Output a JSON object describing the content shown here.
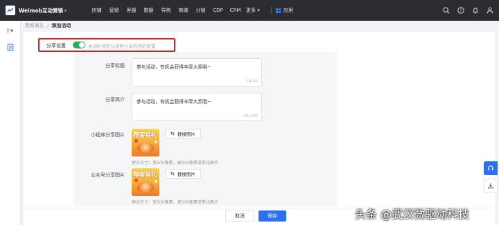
{
  "brand": {
    "name": "Weimob互动营销",
    "caret": "▾"
  },
  "nav": {
    "items": [
      "店铺",
      "营销",
      "客服",
      "数据",
      "导购",
      "商城",
      "分销",
      "CDP",
      "CRM"
    ],
    "more": "更多 ▾",
    "app": "应用"
  },
  "breadcrumb": {
    "parent": "荐客有礼",
    "separator": "/",
    "current": "添加活动"
  },
  "share_setting": {
    "label": "分享设置",
    "enabled": true,
    "hint": "关闭时将默认使用分享内容的配置"
  },
  "share_title": {
    "label": "分享标题",
    "value": "参与活动，有机会获得丰厚大奖哦~",
    "count": "16/40"
  },
  "share_desc": {
    "label": "分享简介",
    "value": "参与活动，有机会获得丰厚大奖哦~",
    "count": "16/100"
  },
  "mini_program_image": {
    "label": "小程序分享图片",
    "thumb_text": "荐客有礼",
    "replace_label": "替换图片",
    "hint": "建议尺寸：宽500像素，高400像素或等比图片"
  },
  "official_image": {
    "label": "公众号分享图片",
    "thumb_text": "荐客有礼",
    "replace_label": "替换图片",
    "hint": "建议尺寸：宽500像素，高500像素或等比图片"
  },
  "footer": {
    "cancel": "取消",
    "save": "保存"
  },
  "watermark": "头条 @武汉微驱动科技",
  "colors": {
    "accent": "#2c6ff5",
    "toggle_on": "#21b15f",
    "highlight": "#e02020",
    "nav_bg": "#2b2d33"
  }
}
